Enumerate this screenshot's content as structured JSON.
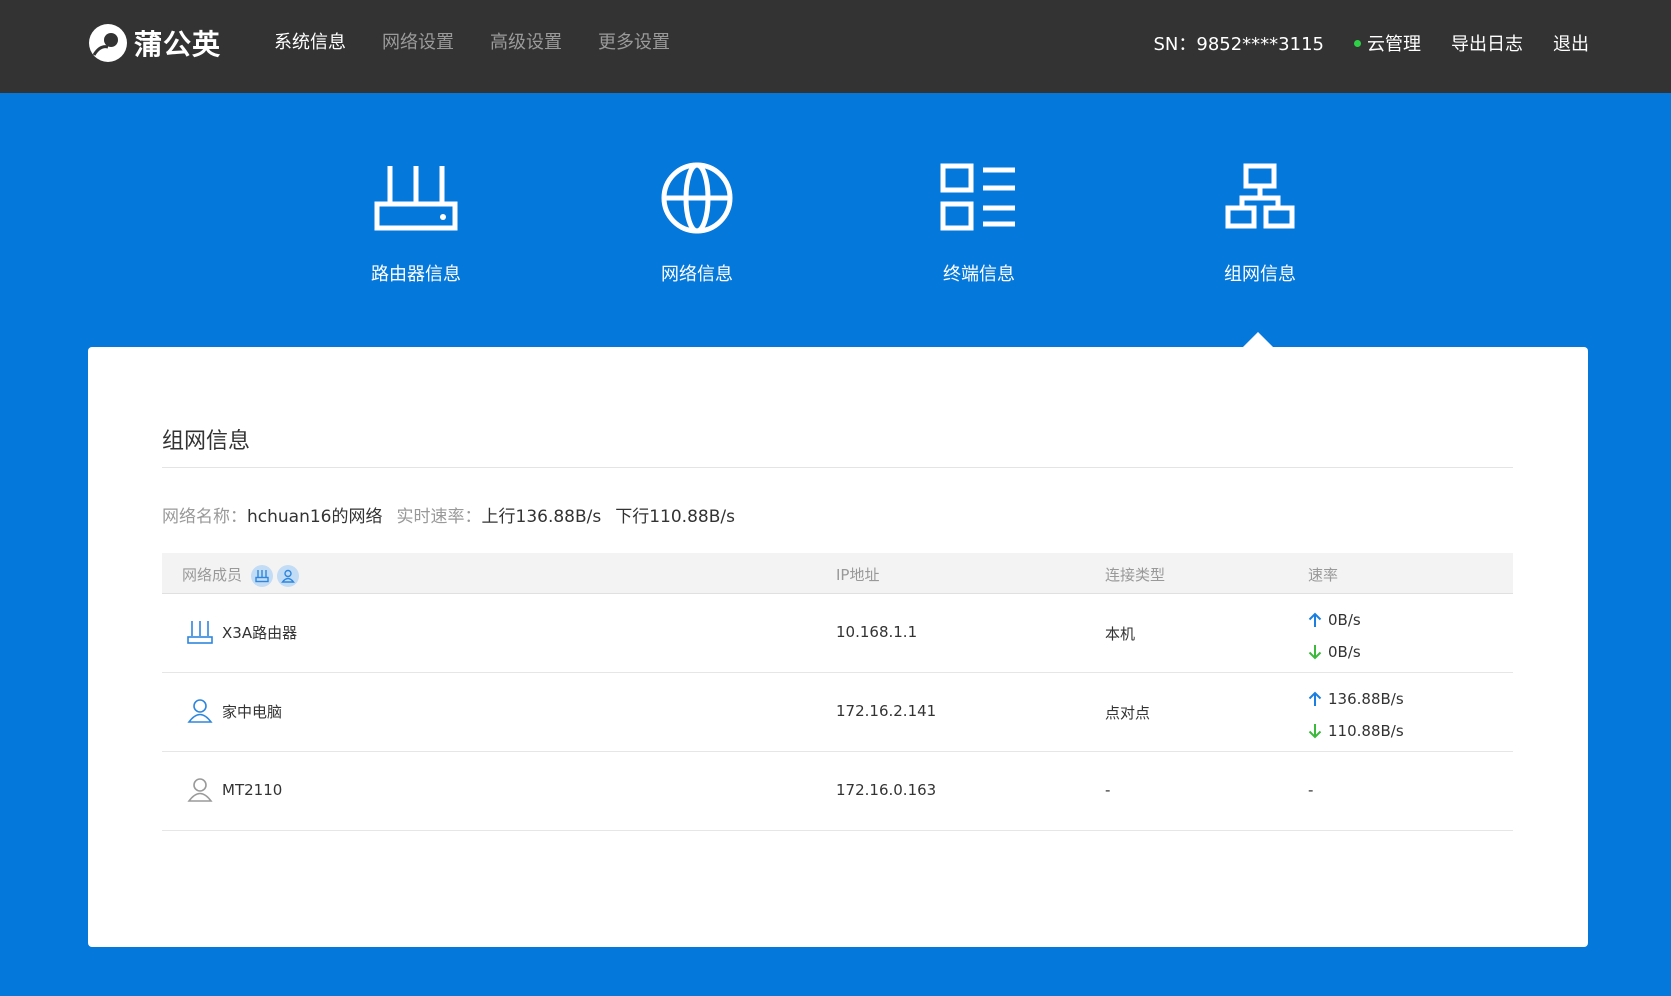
{
  "brand": {
    "name": "蒲公英"
  },
  "nav": {
    "items": [
      {
        "label": "系统信息",
        "active": true
      },
      {
        "label": "网络设置",
        "active": false
      },
      {
        "label": "高级设置",
        "active": false
      },
      {
        "label": "更多设置",
        "active": false
      }
    ]
  },
  "header": {
    "sn": "SN：9852****3115",
    "cloud": "云管理",
    "cloud_status_color": "#2ed146",
    "export_log": "导出日志",
    "logout": "退出"
  },
  "categories": [
    {
      "label": "路由器信息",
      "icon": "router-icon"
    },
    {
      "label": "网络信息",
      "icon": "globe-icon"
    },
    {
      "label": "终端信息",
      "icon": "device-list-icon"
    },
    {
      "label": "组网信息",
      "icon": "network-topology-icon",
      "selected": true
    }
  ],
  "panel": {
    "title": "组网信息",
    "summary": {
      "network_name_label": "网络名称：",
      "network_name": "hchuan16的网络",
      "speed_label": "实时速率：",
      "up": "上行136.88B/s",
      "down": "下行110.88B/s"
    },
    "table": {
      "headers": {
        "member": "网络成员",
        "ip": "IP地址",
        "type": "连接类型",
        "rate": "速率"
      },
      "rows": [
        {
          "icon": "router-icon",
          "name": "X3A路由器",
          "ip": "10.168.1.1",
          "type": "本机",
          "up": "0B/s",
          "down": "0B/s",
          "online": true
        },
        {
          "icon": "user-icon",
          "name": "家中电脑",
          "ip": "172.16.2.141",
          "type": "点对点",
          "up": "136.88B/s",
          "down": "110.88B/s",
          "online": true
        },
        {
          "icon": "user-icon",
          "name": "MT2110",
          "ip": "172.16.0.163",
          "type": "-",
          "rate": "-",
          "online": false
        }
      ]
    }
  },
  "colors": {
    "topbar": "#333333",
    "background": "#0578dc",
    "up_arrow": "#1a7fe0",
    "down_arrow": "#3cb83c"
  }
}
